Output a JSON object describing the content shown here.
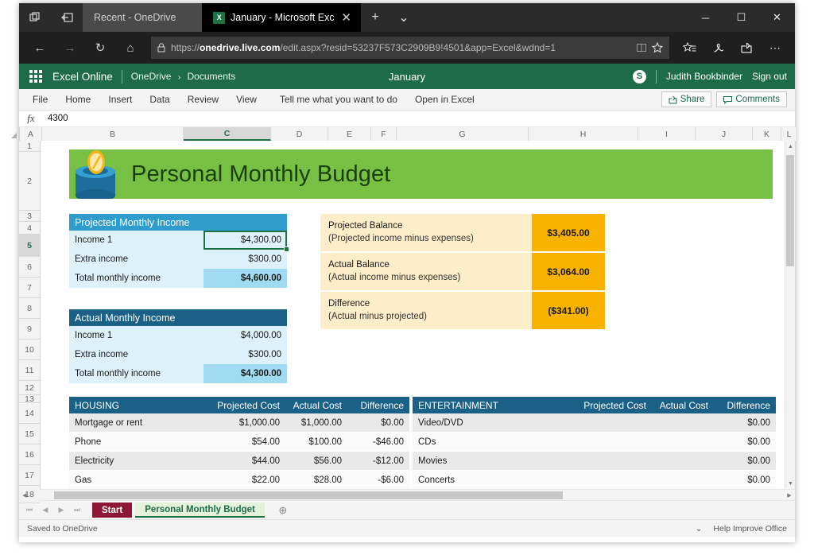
{
  "browser": {
    "tabs": [
      {
        "title": "Recent - OneDrive",
        "active": false,
        "icon": ""
      },
      {
        "title": "January - Microsoft Exc",
        "active": true,
        "icon": "X"
      }
    ],
    "new_tab_label": "+",
    "tab_menu_label": "⌄",
    "close_label": "✕",
    "window_controls": {
      "minimize": "─",
      "maximize": "☐",
      "close": "✕"
    },
    "nav": {
      "back": "←",
      "forward": "→",
      "refresh": "↻",
      "home": "⌂"
    },
    "url": {
      "lock_icon": "lock-icon",
      "scheme": "https://",
      "domain": "onedrive.live.com",
      "path": "/edit.aspx?resid=53237F573C2909B9!4501&app=Excel&wdnd=1",
      "full": "https://onedrive.live.com/edit.aspx?resid=53237F573C2909B9!4501&app=Excel&wdnd=1",
      "reading_view_icon": "reading-view-icon",
      "favorite_icon": "star-icon"
    },
    "toolbar_icons": [
      "hub-favorites-icon",
      "web-note-pen-icon",
      "share-icon",
      "more-settings-icon"
    ]
  },
  "office": {
    "app_launcher": "waffle-icon",
    "brand": "Excel Online",
    "breadcrumb": {
      "root": "OneDrive",
      "separator": "›",
      "child": "Documents"
    },
    "document_name": "January",
    "skype_icon": "S",
    "user_name": "Judith Bookbinder",
    "sign_out": "Sign out",
    "accent_color": "#1e6b4a"
  },
  "ribbon": {
    "tabs": [
      "File",
      "Home",
      "Insert",
      "Data",
      "Review",
      "View"
    ],
    "tell_me": "Tell me what you want to do",
    "open_in_excel": "Open in Excel",
    "share_label": "Share",
    "comments_label": "Comments"
  },
  "formula_bar": {
    "fx_label": "fx",
    "value": "4300"
  },
  "grid": {
    "columns": [
      "A",
      "B",
      "C",
      "D",
      "E",
      "F",
      "G",
      "H",
      "I",
      "J",
      "K",
      "L"
    ],
    "selected_column": "C",
    "rows": [
      "1",
      "2",
      "3",
      "4",
      "5",
      "6",
      "7",
      "8",
      "9",
      "10",
      "11",
      "12",
      "13",
      "14",
      "15",
      "16",
      "17",
      "18"
    ],
    "selected_row": "5"
  },
  "spreadsheet": {
    "banner": {
      "title": "Personal Monthly Budget",
      "bg_color": "#78c043",
      "icon": "coin-bank-icon"
    },
    "projected_income": {
      "header": "Projected Monthly Income",
      "rows": [
        {
          "label": "Income 1",
          "value": "$4,300.00",
          "selected": true
        },
        {
          "label": "Extra income",
          "value": "$300.00",
          "selected": false
        }
      ],
      "total_label": "Total monthly income",
      "total_value": "$4,600.00"
    },
    "actual_income": {
      "header": "Actual Monthly Income",
      "rows": [
        {
          "label": "Income 1",
          "value": "$4,000.00",
          "selected": false
        },
        {
          "label": "Extra income",
          "value": "$300.00",
          "selected": false
        }
      ],
      "total_label": "Total monthly income",
      "total_value": "$4,300.00"
    },
    "balances": [
      {
        "title": "Projected Balance",
        "subtitle": "(Projected income minus expenses)",
        "amount": "$3,405.00"
      },
      {
        "title": "Actual Balance",
        "subtitle": "(Actual income minus expenses)",
        "amount": "$3,064.00"
      },
      {
        "title": "Difference",
        "subtitle": "(Actual minus projected)",
        "amount": "($341.00)"
      }
    ],
    "housing": {
      "header": "HOUSING",
      "columns": [
        "Projected Cost",
        "Actual Cost",
        "Difference"
      ],
      "rows": [
        {
          "name": "Mortgage or rent",
          "projected": "$1,000.00",
          "actual": "$1,000.00",
          "difference": "$0.00"
        },
        {
          "name": "Phone",
          "projected": "$54.00",
          "actual": "$100.00",
          "difference": "-$46.00"
        },
        {
          "name": "Electricity",
          "projected": "$44.00",
          "actual": "$56.00",
          "difference": "-$12.00"
        },
        {
          "name": "Gas",
          "projected": "$22.00",
          "actual": "$28.00",
          "difference": "-$6.00"
        }
      ]
    },
    "entertainment": {
      "header": "ENTERTAINMENT",
      "columns": [
        "Projected Cost",
        "Actual Cost",
        "Difference"
      ],
      "rows": [
        {
          "name": "Video/DVD",
          "projected": "",
          "actual": "",
          "difference": "$0.00"
        },
        {
          "name": "CDs",
          "projected": "",
          "actual": "",
          "difference": "$0.00"
        },
        {
          "name": "Movies",
          "projected": "",
          "actual": "",
          "difference": "$0.00"
        },
        {
          "name": "Concerts",
          "projected": "",
          "actual": "",
          "difference": "$0.00"
        }
      ]
    },
    "colors": {
      "table_header": "#1b6087",
      "income_header": "#2e9ccc",
      "income_cell": "#ddf1fa",
      "income_total": "#9fdcf2",
      "balance_text_bg": "#fdeec9",
      "balance_amount_bg": "#f7b300"
    }
  },
  "sheet_tabs": {
    "nav_first": "⏮",
    "nav_prev": "◀",
    "nav_next": "▶",
    "nav_last": "⏭",
    "tabs": [
      {
        "label": "Start",
        "active": false
      },
      {
        "label": "Personal Monthly Budget",
        "active": true
      }
    ],
    "add_label": "⊕"
  },
  "status_bar": {
    "save_state": "Saved to OneDrive",
    "chevron": "⌄",
    "help": "Help Improve Office"
  }
}
